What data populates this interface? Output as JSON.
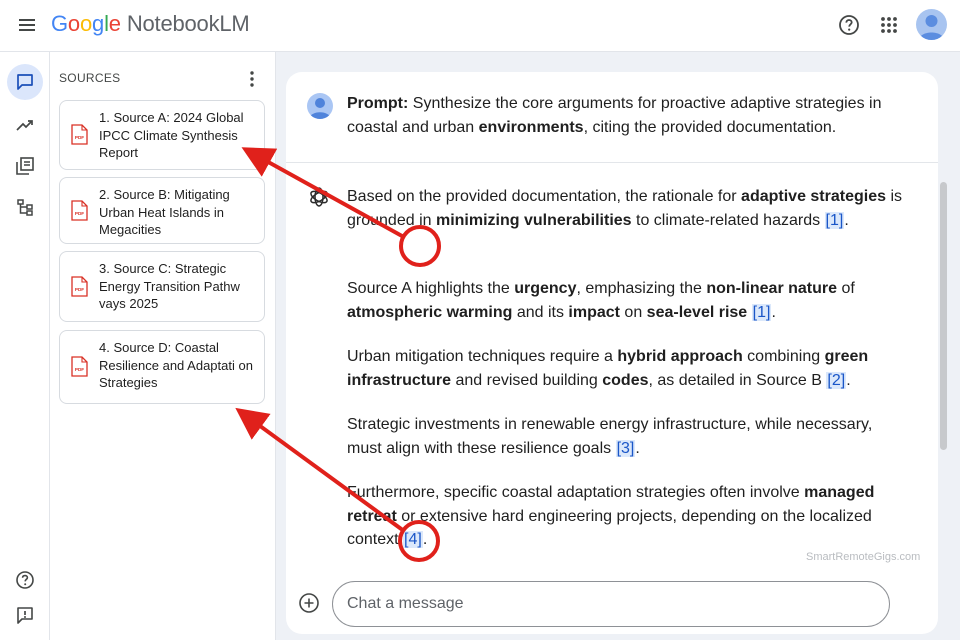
{
  "app": {
    "logo_letters": [
      "G",
      "o",
      "o",
      "g",
      "l",
      "e"
    ],
    "product": "NotebookLM"
  },
  "sources": {
    "title": "SOURCES",
    "items": [
      {
        "label": "1. Source A: 2024 Global IPCC Climate Synthesis Report",
        "icon": "pdf-icon"
      },
      {
        "label": "2. Source B: Mitigating Urban Heat Islands in Megacities",
        "icon": "pdf-icon"
      },
      {
        "label": "3. Source C: Strategic Energy Transition Pathw vays 2025",
        "icon": "pdf-icon"
      },
      {
        "label": "4. Source D: Coastal Resilience and Adaptati on Strategies",
        "icon": "pdf-icon"
      }
    ]
  },
  "prompt": {
    "label": "Prompt:",
    "text_1": " Synthesize the core arguments for proactive adaptive strategies in coastal and urban ",
    "bold_1": "environments",
    "text_2": ", citing the provided documentation."
  },
  "response": {
    "p1": {
      "t1": "Based on the provided documentation, the rationale for ",
      "b1": "adaptive strategies",
      "t2": " is grounded in ",
      "b2": "minimizing vulnerabilities",
      "t3": " to climate-related hazards ",
      "cite": "[1]",
      "t4": "."
    },
    "p2": {
      "t1": "Source A highlights the ",
      "b1": "urgency",
      "t2": ", emphasizing the ",
      "b2": "non-linear nature",
      "t3": " of ",
      "b3": "atmospheric warming",
      "t4": " and its ",
      "b4": "impact",
      "t5": " on ",
      "b5": "sea-level rise",
      "t6": " ",
      "cite": "[1]",
      "t7": "."
    },
    "p3": {
      "t1": "Urban mitigation techniques require a ",
      "b1": "hybrid approach",
      "t2": " combining ",
      "b2": "green infrastructure",
      "t3": " and revised building ",
      "b3": "codes",
      "t4": ", as detailed in Source B ",
      "cite": "[2]",
      "t5": "."
    },
    "p4": {
      "t1": "Strategic investments in renewable energy infrastructure, while necessary, must align with these resilience goals ",
      "cite": "[3]",
      "t2": "."
    },
    "p5": {
      "t1": "Furthermore, specific coastal adaptation strategies often involve ",
      "b1": "managed retreat",
      "t2": " or extensive hard engineering projects, depending on the localized context ",
      "cite": "[4]",
      "t3": "."
    }
  },
  "chat": {
    "placeholder": "Chat a message"
  },
  "watermark": "SmartRemoteGigs.com",
  "colors": {
    "accent": "#1a56c8",
    "cite_bg": "#dbe8fb",
    "annotation": "#e0211b",
    "pdf_red": "#d93025"
  }
}
